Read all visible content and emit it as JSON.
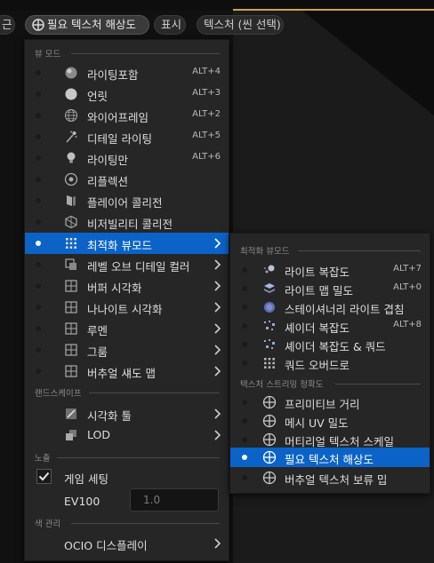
{
  "toolbar": {
    "left_fragment": "근",
    "resolution_button": "필요 텍스처 해상도",
    "show_button": "표시",
    "texture_button": "텍스처 (씬 선택)"
  },
  "main_menu": {
    "sections": {
      "view_mode": "뷰 모드",
      "landscape": "랜드스케이프",
      "exposure": "노출",
      "color_management": "색 관리"
    },
    "items": [
      {
        "label": "라이팅포함",
        "shortcut": "ALT+4",
        "icon": "lit-sphere-icon"
      },
      {
        "label": "언릿",
        "shortcut": "ALT+3",
        "icon": "unlit-sphere-icon"
      },
      {
        "label": "와이어프레임",
        "shortcut": "ALT+2",
        "icon": "wireframe-sphere-icon"
      },
      {
        "label": "디테일 라이팅",
        "shortcut": "ALT+5",
        "icon": "detail-lighting-icon"
      },
      {
        "label": "라이팅만",
        "shortcut": "ALT+6",
        "icon": "light-bulb-icon"
      },
      {
        "label": "리플렉션",
        "shortcut": "",
        "icon": "reflection-icon"
      },
      {
        "label": "플레이어 콜리전",
        "shortcut": "",
        "icon": "player-collision-icon"
      },
      {
        "label": "비저빌리티 콜리전",
        "shortcut": "",
        "icon": "visibility-collision-icon"
      },
      {
        "label": "최적화 뷰모드",
        "shortcut": "",
        "icon": "optimization-grid-icon"
      },
      {
        "label": "레벨 오브 디테일 컬러",
        "shortcut": "",
        "icon": "lod-coloration-icon"
      },
      {
        "label": "버퍼 시각화",
        "shortcut": "",
        "icon": "buffer-visualization-icon"
      },
      {
        "label": "나나이트 시각화",
        "shortcut": "",
        "icon": "nanite-visualization-icon"
      },
      {
        "label": "루멘",
        "shortcut": "",
        "icon": "lumen-icon"
      },
      {
        "label": "그룸",
        "shortcut": "",
        "icon": "groom-icon"
      },
      {
        "label": "버추얼 섀도 맵",
        "shortcut": "",
        "icon": "virtual-shadow-map-icon"
      }
    ],
    "landscape_items": [
      {
        "label": "시각화 툴",
        "icon": "visualizer-tools-icon"
      },
      {
        "label": "LOD",
        "icon": "lod-icon"
      }
    ],
    "exposure": {
      "game_settings_label": "게임 세팅",
      "game_settings_checked": true,
      "ev100_label": "EV100",
      "ev100_value": "1.0"
    },
    "color_item": "OCIO 디스플레이"
  },
  "sub_menu": {
    "sections": {
      "optimization": "최적화 뷰모드",
      "texture_streaming": "텍스처 스트리밍 정확도"
    },
    "items": [
      {
        "label": "라이트 복잡도",
        "shortcut": "ALT+7",
        "icon": "light-complexity-icon"
      },
      {
        "label": "라이트 맵 밀도",
        "shortcut": "ALT+0",
        "icon": "lightmap-density-icon"
      },
      {
        "label": "스테이셔너리 라이트 겹침",
        "shortcut": "",
        "icon": "stationary-light-overlap-icon"
      },
      {
        "label": "셰이더 복잡도",
        "shortcut": "ALT+8",
        "icon": "shader-complexity-icon"
      },
      {
        "label": "셰이더 복잡도 & 쿼드",
        "shortcut": "",
        "icon": "shader-complexity-quads-icon"
      },
      {
        "label": "쿼드 오버드로",
        "shortcut": "",
        "icon": "quad-overdraw-icon"
      }
    ],
    "streaming_items": [
      {
        "label": "프리미티브 거리",
        "icon": "primitive-distance-icon"
      },
      {
        "label": "메시 UV 밀도",
        "icon": "mesh-uv-density-icon"
      },
      {
        "label": "머티리얼 텍스처 스케일",
        "icon": "material-texture-scale-icon"
      },
      {
        "label": "필요 텍스처 해상도",
        "icon": "required-texture-resolution-icon"
      },
      {
        "label": "버추얼 텍스처 보류 밉",
        "icon": "virtual-texture-pending-mips-icon"
      }
    ]
  },
  "colors": {
    "highlight": "#0b63c7",
    "menu_background": "#262626",
    "accent_line": "#c9a64a"
  }
}
